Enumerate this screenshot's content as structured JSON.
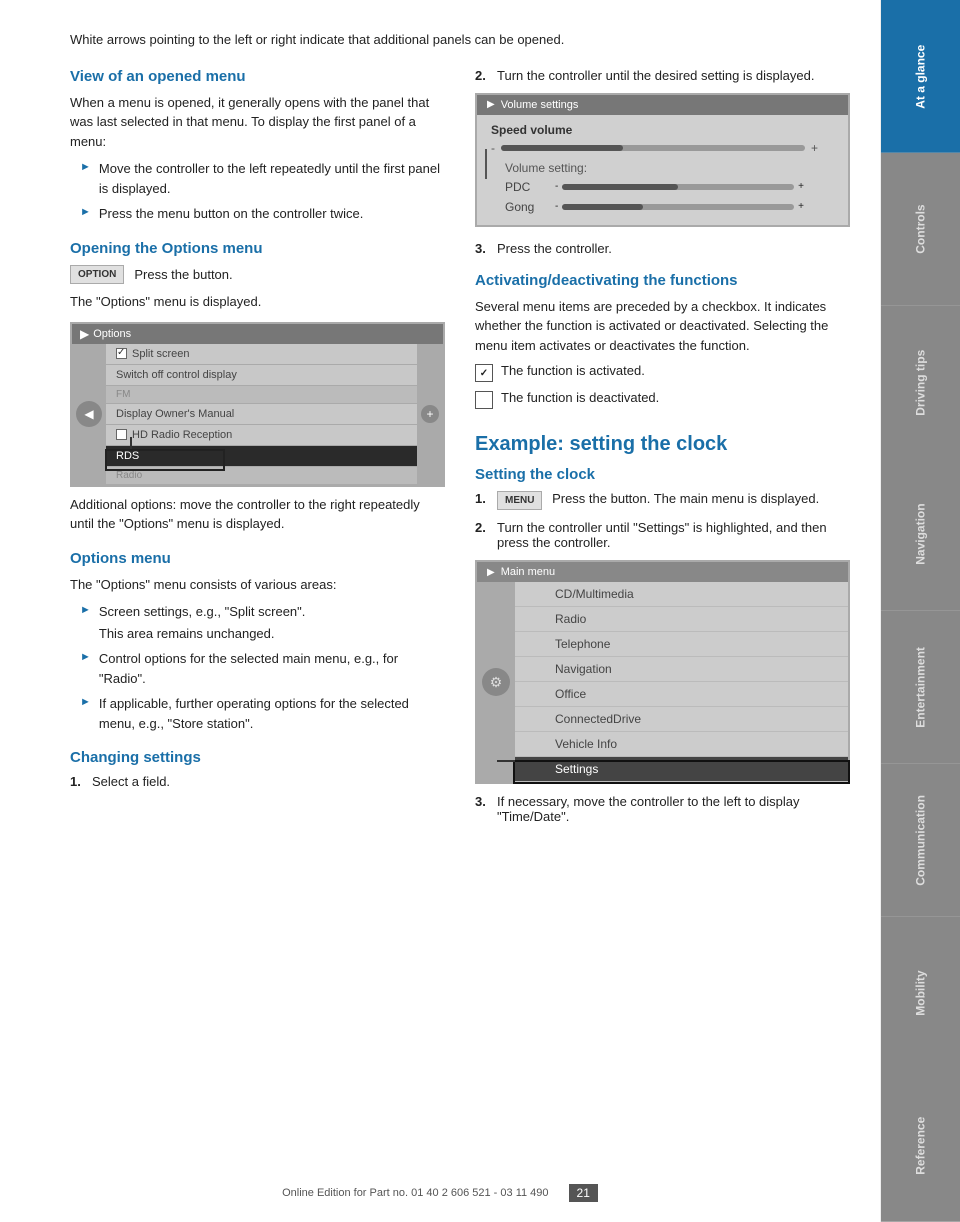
{
  "intro": {
    "text": "White arrows pointing to the left or right indicate that additional panels can be opened."
  },
  "sections": {
    "view_opened_menu": {
      "heading": "View of an opened menu",
      "body": "When a menu is opened, it generally opens with the panel that was last selected in that menu. To display the first panel of a menu:",
      "bullets": [
        "Move the controller to the left repeatedly until the first panel is displayed.",
        "Press the menu button on the controller twice."
      ]
    },
    "opening_options": {
      "heading": "Opening the Options menu",
      "btn_label": "OPTION",
      "btn_text": "Press the button.",
      "after_text": "The \"Options\" menu is displayed.",
      "additional_text": "Additional options: move the controller to the right repeatedly until the \"Options\" menu is displayed."
    },
    "options_menu": {
      "heading": "Options menu",
      "body": "The \"Options\" menu consists of various areas:",
      "bullets": [
        {
          "text": "Screen settings, e.g., \"Split screen\".",
          "sub": "This area remains unchanged."
        },
        {
          "text": "Control options for the selected main menu, e.g., for \"Radio\"."
        },
        {
          "text": "If applicable, further operating options for the selected menu, e.g., \"Store station\"."
        }
      ]
    },
    "changing_settings": {
      "heading": "Changing settings",
      "step1": "Select a field."
    }
  },
  "right_col": {
    "step2_text": "Turn the controller until the desired setting is displayed.",
    "step3_text": "Press the controller.",
    "activating_heading": "Activating/deactivating the functions",
    "activating_body": "Several menu items are preceded by a checkbox. It indicates whether the function is activated or deactivated. Selecting the menu item activates or deactivates the function.",
    "func_activated": "The function is activated.",
    "func_deactivated": "The function is deactivated.",
    "example_heading": "Example: setting the clock",
    "setting_clock_heading": "Setting the clock",
    "step1_clock": "Press the button. The main menu is displayed.",
    "step2_clock": "Turn the controller until \"Settings\" is highlighted, and then press the controller.",
    "step3_clock": "If necessary, move the controller to the left to display \"Time/Date\"."
  },
  "options_screen": {
    "title": "Options",
    "items": [
      {
        "label": "Split screen",
        "type": "checked",
        "checked": true
      },
      {
        "label": "Switch off control display",
        "type": "normal"
      },
      {
        "label": "FM",
        "type": "section"
      },
      {
        "label": "Display Owner's Manual",
        "type": "normal"
      },
      {
        "label": "HD Radio Reception",
        "type": "checkbox",
        "checked": false
      },
      {
        "label": "RDS",
        "type": "highlighted"
      },
      {
        "label": "Radio",
        "type": "section"
      }
    ]
  },
  "volume_screen": {
    "title": "Volume settings",
    "speed_volume_label": "Speed volume",
    "volume_setting_label": "Volume setting:",
    "pdc_label": "PDC",
    "gong_label": "Gong"
  },
  "main_menu_screen": {
    "title": "Main menu",
    "items": [
      "CD/Multimedia",
      "Radio",
      "Telephone",
      "Navigation",
      "Office",
      "ConnectedDrive",
      "Vehicle Info",
      "Settings"
    ]
  },
  "sidebar": {
    "tabs": [
      {
        "label": "At a glance",
        "active": true
      },
      {
        "label": "Controls",
        "active": false
      },
      {
        "label": "Driving tips",
        "active": false
      },
      {
        "label": "Navigation",
        "active": false
      },
      {
        "label": "Entertainment",
        "active": false
      },
      {
        "label": "Communication",
        "active": false
      },
      {
        "label": "Mobility",
        "active": false
      },
      {
        "label": "Reference",
        "active": false
      }
    ]
  },
  "footer": {
    "text": "Online Edition for Part no. 01 40 2 606 521 - 03 11 490",
    "page_number": "21"
  }
}
